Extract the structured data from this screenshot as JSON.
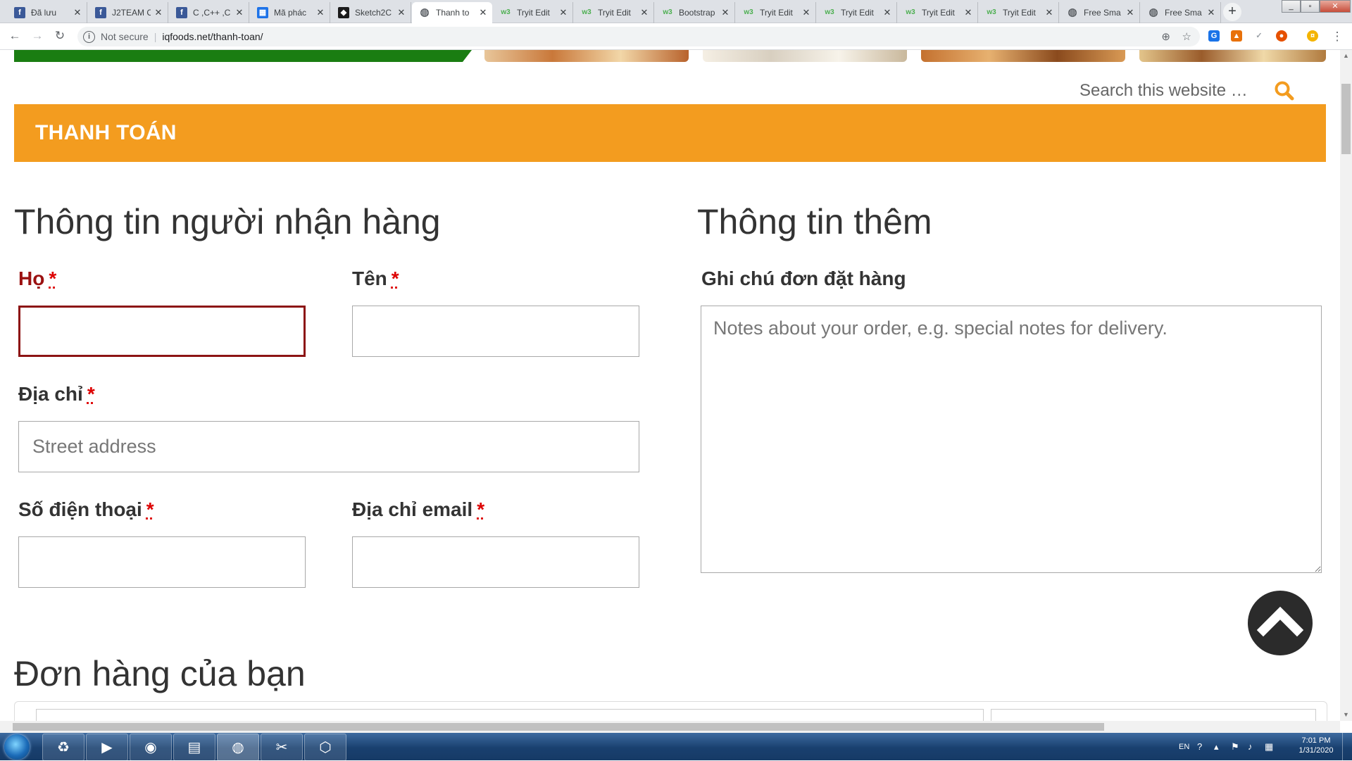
{
  "browser": {
    "tabs": [
      {
        "title": "Đã lưu",
        "favicon": "facebook-icon"
      },
      {
        "title": "J2TEAM C",
        "favicon": "facebook-icon"
      },
      {
        "title": "C ,C++ ,C",
        "favicon": "facebook-icon"
      },
      {
        "title": "Mã phác",
        "favicon": "windows-icon"
      },
      {
        "title": "Sketch2C",
        "favicon": "sketch-icon"
      },
      {
        "title": "Thanh to",
        "favicon": "globe-icon",
        "active": true
      },
      {
        "title": "Tryit Edit",
        "favicon": "w3schools-icon"
      },
      {
        "title": "Tryit Edit",
        "favicon": "w3schools-icon"
      },
      {
        "title": "Bootstrap",
        "favicon": "w3schools-icon"
      },
      {
        "title": "Tryit Edit",
        "favicon": "w3schools-icon"
      },
      {
        "title": "Tryit Edit",
        "favicon": "w3schools-icon"
      },
      {
        "title": "Tryit Edit",
        "favicon": "w3schools-icon"
      },
      {
        "title": "Tryit Edit",
        "favicon": "w3schools-icon"
      },
      {
        "title": "Free Sma",
        "favicon": "globe-icon"
      },
      {
        "title": "Free Sma",
        "favicon": "globe-icon"
      }
    ],
    "security_label": "Not secure",
    "url": "iqfoods.net/thanh-toan/"
  },
  "page": {
    "search_placeholder": "Search this website …",
    "title_bar": "THANH TOÁN",
    "recipient": {
      "heading": "Thông tin người nhận hàng",
      "last_name_label": "Họ",
      "first_name_label": "Tên",
      "address_label": "Địa chỉ",
      "address_placeholder": "Street address",
      "phone_label": "Số điện thoại",
      "email_label": "Địa chỉ email",
      "required_mark": "*"
    },
    "extra": {
      "heading": "Thông tin thêm",
      "notes_label": "Ghi chú đơn đặt hàng",
      "notes_placeholder": "Notes about your order, e.g. special notes for delivery."
    },
    "order": {
      "heading": "Đơn hàng của bạn"
    },
    "colors": {
      "title_bar": "#f39c1f",
      "banner_green": "#1a7d12",
      "error": "#9b1111",
      "required": "#dd0000"
    }
  },
  "taskbar": {
    "apps": [
      "recycle-icon",
      "media-player-icon",
      "firefox-icon",
      "file-explorer-icon",
      "chrome-icon",
      "snipping-tool-icon",
      "virtualbox-icon"
    ],
    "language": "EN",
    "time": "7:01 PM",
    "date": "1/31/2020"
  }
}
